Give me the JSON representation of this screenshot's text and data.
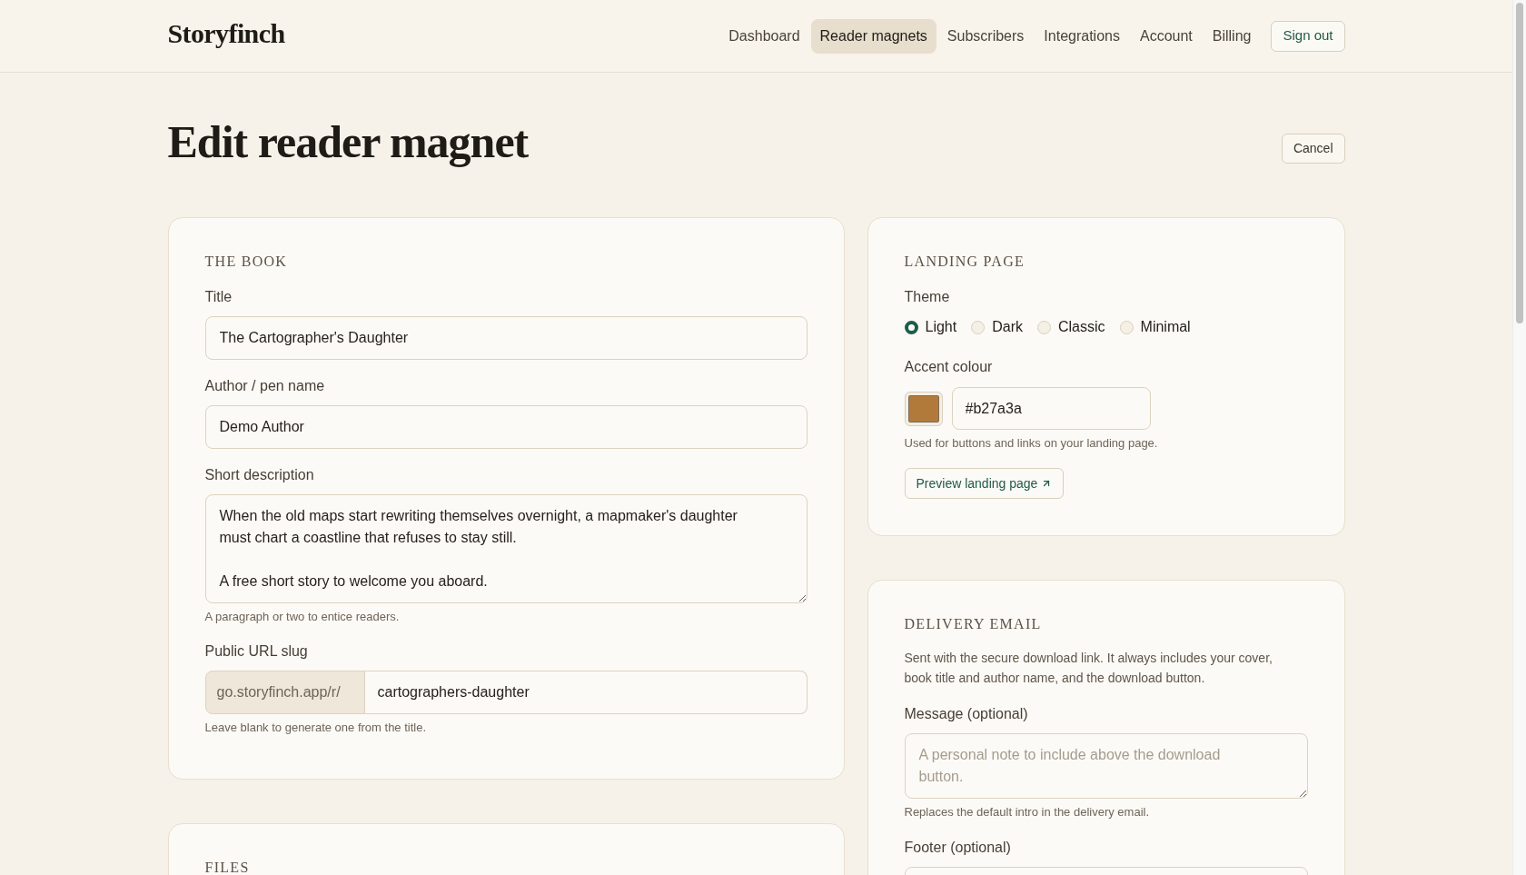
{
  "header": {
    "logo": "Storyfinch",
    "nav": [
      {
        "label": "Dashboard",
        "selected": false
      },
      {
        "label": "Reader magnets",
        "selected": true
      },
      {
        "label": "Subscribers",
        "selected": false
      },
      {
        "label": "Integrations",
        "selected": false
      },
      {
        "label": "Account",
        "selected": false
      },
      {
        "label": "Billing",
        "selected": false
      }
    ],
    "sign_out": "Sign out"
  },
  "page": {
    "title": "Edit reader magnet",
    "cancel": "Cancel"
  },
  "the_book": {
    "heading": "THE BOOK",
    "fields": [
      {
        "kind": "text",
        "label": "Title",
        "value": "The Cartographer's Daughter"
      },
      {
        "kind": "text",
        "label": "Author / pen name",
        "value": "Demo Author"
      },
      {
        "kind": "textarea",
        "label": "Short description",
        "value": "When the old maps start rewriting themselves overnight, a mapmaker's daughter must chart a coastline that refuses to stay still.\n\nA free short story to welcome you aboard.",
        "hint": "A paragraph or two to entice readers."
      },
      {
        "kind": "slug",
        "label": "Public URL slug",
        "prefix": "go.storyfinch.app/r/",
        "value": "cartographers-daughter",
        "hint": "Leave blank to generate one from the title."
      }
    ]
  },
  "files": {
    "heading": "FILES"
  },
  "landing_page": {
    "heading": "LANDING PAGE",
    "theme": {
      "label": "Theme",
      "options": [
        {
          "label": "Light",
          "selected": true
        },
        {
          "label": "Dark",
          "selected": false
        },
        {
          "label": "Classic",
          "selected": false
        },
        {
          "label": "Minimal",
          "selected": false
        }
      ]
    },
    "accent_colour": {
      "label": "Accent colour",
      "color": "#b27a3a",
      "value": "#b27a3a",
      "hint": "Used for buttons and links on your landing page."
    },
    "preview_link": "Preview landing page"
  },
  "delivery_email": {
    "heading": "DELIVERY EMAIL",
    "description": "Sent with the secure download link. It always includes your cover, book title and author name, and the download button.",
    "fields": [
      {
        "kind": "textarea",
        "label": "Message (optional)",
        "placeholder": "A personal note to include above the download button.",
        "hint": "Replaces the default intro in the delivery email."
      },
      {
        "kind": "text",
        "label": "Footer (optional)"
      }
    ]
  }
}
